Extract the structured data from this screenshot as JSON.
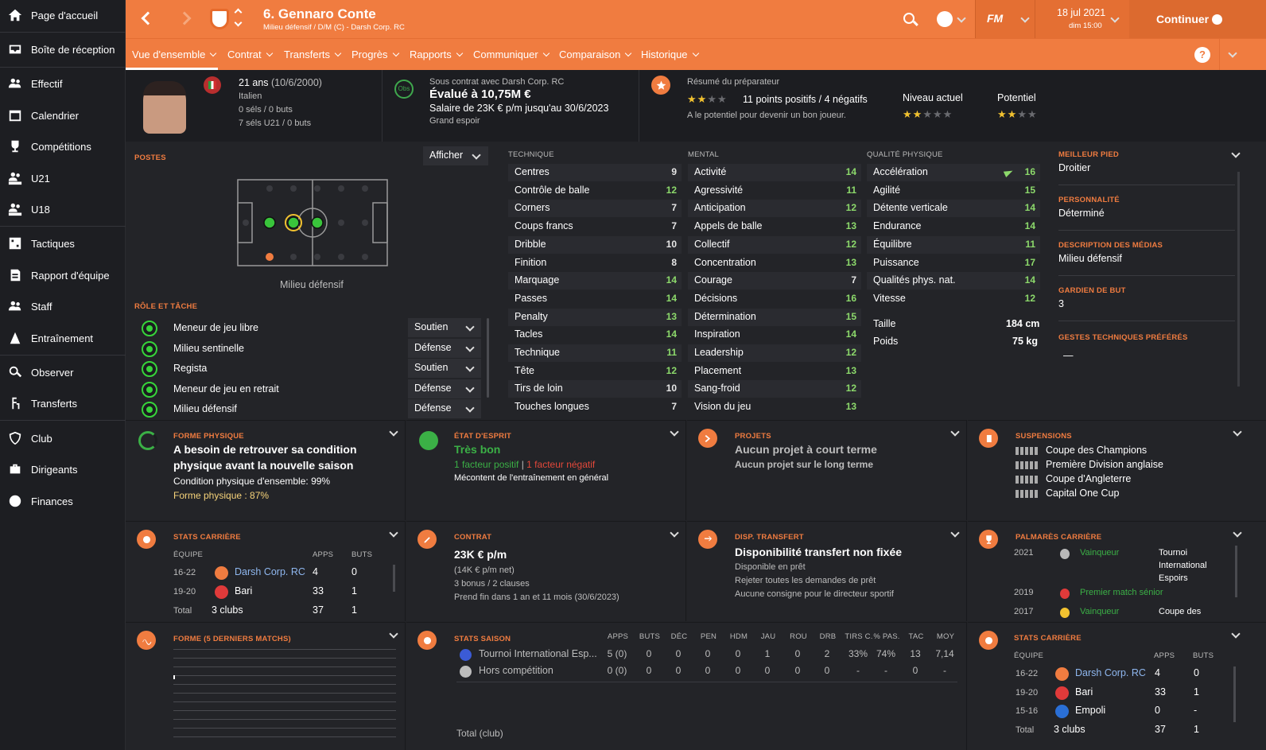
{
  "nav": {
    "items": [
      {
        "label": "Page d'accueil",
        "icon": "home-icon"
      },
      {
        "label": "Boîte de réception",
        "icon": "inbox-icon"
      },
      {
        "label": "Effectif",
        "icon": "squad-icon"
      },
      {
        "label": "Calendrier",
        "icon": "calendar-icon"
      },
      {
        "label": "Compétitions",
        "icon": "trophy-icon"
      },
      {
        "label": "U21",
        "icon": "u21-icon"
      },
      {
        "label": "U18",
        "icon": "u18-icon"
      },
      {
        "label": "Tactiques",
        "icon": "tactics-icon"
      },
      {
        "label": "Rapport d'équipe",
        "icon": "report-icon"
      },
      {
        "label": "Staff",
        "icon": "staff-icon"
      },
      {
        "label": "Entraînement",
        "icon": "training-icon"
      },
      {
        "label": "Observer",
        "icon": "scout-icon"
      },
      {
        "label": "Transferts",
        "icon": "transfers-icon"
      },
      {
        "label": "Club",
        "icon": "club-icon"
      },
      {
        "label": "Dirigeants",
        "icon": "board-icon"
      },
      {
        "label": "Finances",
        "icon": "finances-icon"
      }
    ]
  },
  "top": {
    "player_name": "6. Gennaro Conte",
    "player_sub": "Milieu défensif / D/M (C) - Darsh Corp. RC",
    "date": "18 jul 2021",
    "time": "dim 15:00",
    "fm_logo": "FM",
    "continue_label": "Continuer"
  },
  "subnav": [
    "Vue d'ensemble",
    "Contrat",
    "Transferts",
    "Progrès",
    "Rapports",
    "Communiquer",
    "Comparaison",
    "Historique"
  ],
  "header": {
    "age": "21 ans",
    "dob": "(10/6/2000)",
    "nationality": "Italien",
    "caps": "0 séls / 0 buts",
    "u21caps": "7 séls U21 / 0 buts",
    "obs": "Obs",
    "contract_with": "Sous contrat avec Darsh Corp. RC",
    "value": "Évalué à 10,75M €",
    "wage": "Salaire de 23K € p/m jusqu'au 30/6/2023",
    "status": "Grand espoir",
    "coach_title": "Résumé du préparateur",
    "coach_points": "11 points positifs / 4 négatifs",
    "coach_text": "A le potentiel pour devenir un bon joueur.",
    "current_label": "Niveau actuel",
    "potential_label": "Potentiel",
    "coach_stars": 2,
    "current_stars": 2,
    "potential_stars": 2
  },
  "positions": {
    "label": "POSTES",
    "show_label": "Afficher",
    "pos_name": "Milieu défensif",
    "role_label": "RÔLE ET TÂCHE",
    "roles": [
      {
        "name": "Meneur de jeu libre",
        "duty": "Soutien"
      },
      {
        "name": "Milieu sentinelle",
        "duty": "Défense"
      },
      {
        "name": "Regista",
        "duty": "Soutien"
      },
      {
        "name": "Meneur de jeu en retrait",
        "duty": "Défense"
      },
      {
        "name": "Milieu défensif",
        "duty": "Défense"
      }
    ]
  },
  "attributes": {
    "technical_label": "TECHNIQUE",
    "mental_label": "MENTAL",
    "physical_label": "QUALITÉ PHYSIQUE",
    "technical": [
      {
        "name": "Centres",
        "value": "9"
      },
      {
        "name": "Contrôle de balle",
        "value": "12"
      },
      {
        "name": "Corners",
        "value": "7"
      },
      {
        "name": "Coups francs",
        "value": "7"
      },
      {
        "name": "Dribble",
        "value": "10"
      },
      {
        "name": "Finition",
        "value": "8"
      },
      {
        "name": "Marquage",
        "value": "14"
      },
      {
        "name": "Passes",
        "value": "14"
      },
      {
        "name": "Penalty",
        "value": "13"
      },
      {
        "name": "Tacles",
        "value": "14"
      },
      {
        "name": "Technique",
        "value": "11"
      },
      {
        "name": "Tête",
        "value": "12"
      },
      {
        "name": "Tirs de loin",
        "value": "10"
      },
      {
        "name": "Touches longues",
        "value": "7"
      }
    ],
    "mental": [
      {
        "name": "Activité",
        "value": "14"
      },
      {
        "name": "Agressivité",
        "value": "11"
      },
      {
        "name": "Anticipation",
        "value": "12"
      },
      {
        "name": "Appels de balle",
        "value": "13"
      },
      {
        "name": "Collectif",
        "value": "12"
      },
      {
        "name": "Concentration",
        "value": "13"
      },
      {
        "name": "Courage",
        "value": "7"
      },
      {
        "name": "Décisions",
        "value": "16"
      },
      {
        "name": "Détermination",
        "value": "15"
      },
      {
        "name": "Inspiration",
        "value": "14"
      },
      {
        "name": "Leadership",
        "value": "12"
      },
      {
        "name": "Placement",
        "value": "13"
      },
      {
        "name": "Sang-froid",
        "value": "12"
      },
      {
        "name": "Vision du jeu",
        "value": "13"
      }
    ],
    "physical": [
      {
        "name": "Accélération",
        "value": "16"
      },
      {
        "name": "Agilité",
        "value": "15"
      },
      {
        "name": "Détente verticale",
        "value": "14"
      },
      {
        "name": "Endurance",
        "value": "14"
      },
      {
        "name": "Équilibre",
        "value": "11"
      },
      {
        "name": "Puissance",
        "value": "17"
      },
      {
        "name": "Qualités phys. nat.",
        "value": "14"
      },
      {
        "name": "Vitesse",
        "value": "12"
      }
    ],
    "height_label": "Taille",
    "height": "184 cm",
    "weight_label": "Poids",
    "weight": "75 kg"
  },
  "info": {
    "foot_label": "MEILLEUR PIED",
    "foot": "Droitier",
    "personality_label": "PERSONNALITÉ",
    "personality": "Déterminé",
    "media_label": "DESCRIPTION DES MÉDIAS",
    "media": "Milieu défensif",
    "gk_label": "GARDIEN DE BUT",
    "gk": "3",
    "ppm_label": "GESTES TECHNIQUES PRÉFÉRÉS",
    "ppm": "—"
  },
  "fitness": {
    "label": "FORME PHYSIQUE",
    "title1": "A besoin de retrouver sa condition",
    "title2": "physique avant la nouvelle saison",
    "cond": "Condition physique d'ensemble: 99%",
    "form": "Forme physique : 87%"
  },
  "morale": {
    "label": "ÉTAT D'ESPRIT",
    "value": "Très bon",
    "pos": "1 facteur positif",
    "neg": "1 facteur négatif",
    "text": "Mécontent de l'entraînement en général"
  },
  "plans": {
    "label": "PROJETS",
    "short": "Aucun projet à court terme",
    "long": "Aucun projet sur le long terme"
  },
  "susp": {
    "label": "SUSPENSIONS",
    "items": [
      "Coupe des Champions",
      "Première Division anglaise",
      "Coupe d'Angleterre",
      "Capital One Cup"
    ]
  },
  "career1": {
    "label": "STATS CARRIÈRE",
    "h_team": "ÉQUIPE",
    "h_apps": "APPS",
    "h_goals": "BUTS",
    "rows": [
      {
        "season": "16-22",
        "club": "Darsh Corp. RC",
        "apps": "4",
        "goals": "0"
      },
      {
        "season": "19-20",
        "club": "Bari",
        "apps": "33",
        "goals": "1"
      },
      {
        "season": "Total",
        "club": "3 clubs",
        "apps": "37",
        "goals": "1"
      }
    ]
  },
  "contract": {
    "label": "CONTRAT",
    "wage": "23K € p/m",
    "net": "(14K € p/m net)",
    "bonus": "3 bonus / 2 clauses",
    "end": "Prend fin dans 1 an et 11 mois",
    "end_date": "(30/6/2023)"
  },
  "transfer": {
    "label": "DISP. TRANSFERT",
    "title": "Disponibilité transfert non fixée",
    "l1": "Disponible en prêt",
    "l2": "Rejeter toutes les demandes de prêt",
    "l3": "Aucune consigne pour le directeur sportif"
  },
  "honours": {
    "label": "PALMARÈS CARRIÈRE",
    "rows": [
      {
        "year": "2021",
        "result": "Vainqueur",
        "comp1": "Tournoi",
        "comp2": "International",
        "comp3": "Espoirs"
      },
      {
        "year": "2019",
        "result": "Premier match sénior",
        "comp1": "",
        "comp2": "",
        "comp3": ""
      },
      {
        "year": "2017",
        "result": "Vainqueur",
        "comp1": "Coupe des",
        "comp2": "",
        "comp3": ""
      }
    ]
  },
  "form5": {
    "label": "FORME (5 DERNIERS MATCHS)"
  },
  "season": {
    "label": "STATS SAISON",
    "headers": [
      "APPS",
      "BUTS",
      "DÉC",
      "PEN",
      "HDM",
      "JAU",
      "ROU",
      "DRB",
      "TIRS C.",
      "% PAS.",
      "TAC",
      "MOY"
    ],
    "rows": [
      {
        "name": "Tournoi International Esp...",
        "vals": [
          "5 (0)",
          "0",
          "0",
          "0",
          "0",
          "1",
          "0",
          "2",
          "33%",
          "74%",
          "13",
          "7,14"
        ]
      },
      {
        "name": "Hors compétition",
        "vals": [
          "0 (0)",
          "0",
          "0",
          "0",
          "0",
          "0",
          "0",
          "0",
          "-",
          "-",
          "0",
          "-"
        ]
      }
    ],
    "total": "Total (club)"
  },
  "career2": {
    "label": "STATS CARRIÈRE",
    "h_team": "ÉQUIPE",
    "h_apps": "APPS",
    "h_goals": "BUTS",
    "rows": [
      {
        "season": "16-22",
        "club": "Darsh Corp. RC",
        "apps": "4",
        "goals": "0"
      },
      {
        "season": "19-20",
        "club": "Bari",
        "apps": "33",
        "goals": "1"
      },
      {
        "season": "15-16",
        "club": "Empoli",
        "apps": "0",
        "goals": "-"
      },
      {
        "season": "Total",
        "club": "3 clubs",
        "apps": "37",
        "goals": "1"
      }
    ]
  },
  "colors": {
    "accent": "#f07c40",
    "good": "#8cd96b",
    "green": "#37d43a",
    "bg": "#222327"
  }
}
